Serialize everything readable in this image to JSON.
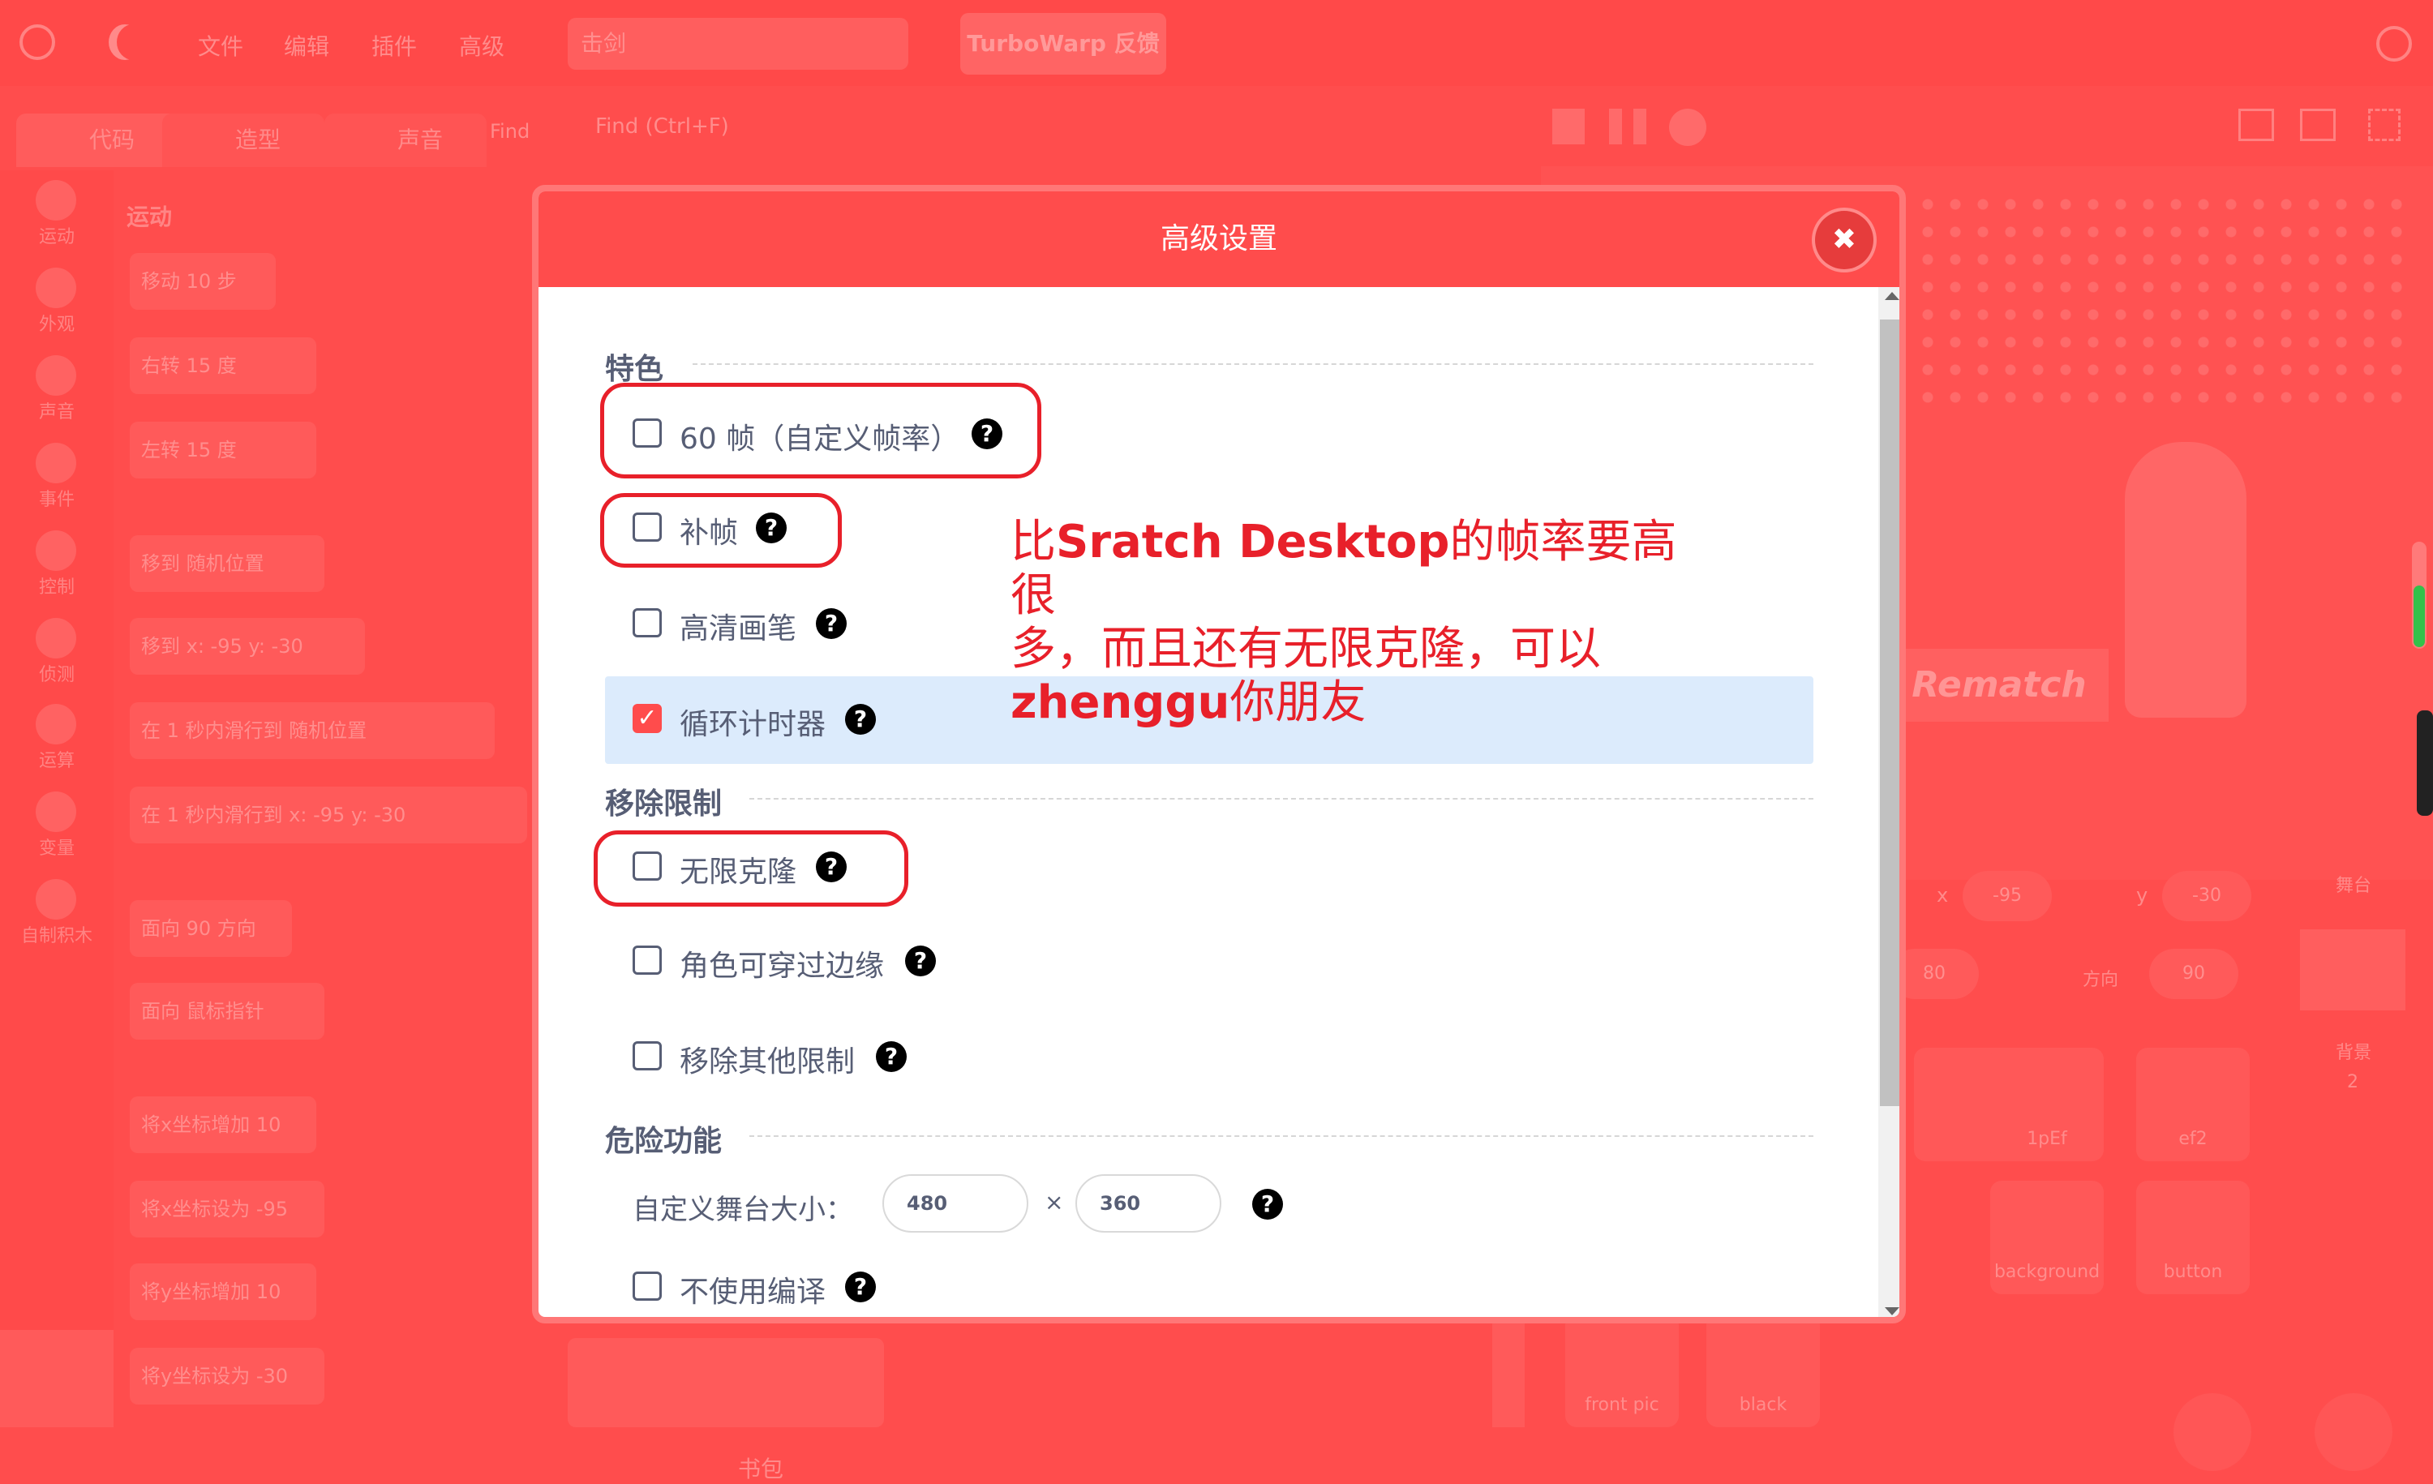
{
  "menubar": {
    "items": [
      "文件",
      "编辑",
      "插件",
      "高级"
    ],
    "project_title": "击剑",
    "feedback_label": "TurboWarp 反馈"
  },
  "editor": {
    "tabs": [
      "代码",
      "造型",
      "声音"
    ],
    "find_label": "Find",
    "find_placeholder": "Find (Ctrl+F)",
    "categories": [
      "运动",
      "外观",
      "声音",
      "事件",
      "控制",
      "侦测",
      "运算",
      "变量",
      "自制积木"
    ],
    "palette_heading": "运动",
    "blocks": [
      "移动 10 步",
      "右转 15 度",
      "左转 15 度",
      "移到 随机位置",
      "移到 x: -95 y: -30",
      "在 1 秒内滑行到 随机位置",
      "在 1 秒内滑行到 x: -95 y: -30",
      "面向 90 方向",
      "面向 鼠标指针",
      "将x坐标增加 10",
      "将x坐标设为 -95",
      "将y坐标增加 10",
      "将y坐标设为 -30"
    ],
    "backpack_label": "书包"
  },
  "stage": {
    "rematch_label": "Rematch",
    "x_value": "-95",
    "y_value": "-30",
    "size_value": "80",
    "direction_label": "方向",
    "direction_value": "90",
    "stage_label": "舞台",
    "backdrop_label": "背景",
    "backdrop_count": "2",
    "sprites": [
      "1pEf",
      "ef2",
      "background",
      "button",
      "front pic",
      "black"
    ]
  },
  "modal": {
    "title": "高级设置",
    "close_icon": "close-icon",
    "sections": {
      "features": "特色",
      "remove_limits": "移除限制",
      "danger": "危险功能"
    },
    "options": {
      "fps60": {
        "label": "60 帧（自定义帧率）",
        "checked": false
      },
      "interpolation": {
        "label": "补帧",
        "checked": false
      },
      "hq_pen": {
        "label": "高清画笔",
        "checked": false
      },
      "warp_timer": {
        "label": "循环计时器",
        "checked": true
      },
      "infinite_clones": {
        "label": "无限克隆",
        "checked": false
      },
      "fencing": {
        "label": "角色可穿过边缘",
        "checked": false
      },
      "misc_limits": {
        "label": "移除其他限制",
        "checked": false
      },
      "disable_compiler": {
        "label": "不使用编译",
        "checked": false
      }
    },
    "stage_size": {
      "label": "自定义舞台大小：",
      "width": "480",
      "times": "×",
      "height": "360"
    }
  },
  "annotation": {
    "line1_prefix": "比",
    "line1_bold": "Sratch Desktop",
    "line1_suffix": "的帧率要高很",
    "line2": "多，而且还有无限克隆，可以",
    "line3_bold": "zhenggu",
    "line3_suffix": "你朋友"
  },
  "colors": {
    "accent": "#ff4c4c",
    "text": "#575e75",
    "highlight_row": "#dcebfc",
    "annotation": "#e8202a"
  }
}
